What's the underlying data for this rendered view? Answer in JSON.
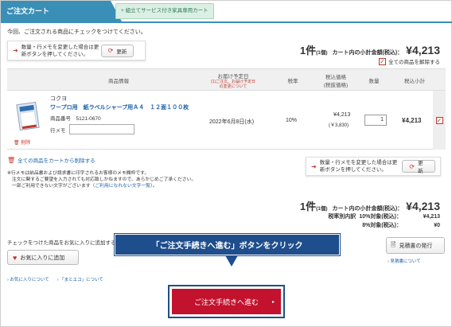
{
  "tabs": {
    "active": "ご注文カート",
    "inactive": "組立てサービス付き家具専用カート",
    "inactive_icon": "plus-icon"
  },
  "notice": "今回、ご注文される商品にチェックをつけてください。",
  "update_box": {
    "message": "数量・行メモを変更した場合は更新ボタンを押してください。",
    "button": "更新"
  },
  "summary": {
    "count": "1件",
    "count_sub": "(1個)",
    "subtotal_label": "カート内の小計金額(税込)：",
    "subtotal": "¥4,213",
    "remove_checked": "全ての商品を解除する"
  },
  "table": {
    "headers": {
      "product": "商品情報",
      "delivery": "お届け予定日",
      "delivery_sub1": "(1)ご注文、お届け予定日",
      "delivery_sub2": "の変更について",
      "tax_rate": "税率",
      "price": "税込価格",
      "price_sub": "(税抜価格)",
      "qty": "数量",
      "line_total": "税込小計"
    },
    "item": {
      "maker": "コクヨ",
      "name": "ワープロ用　紙ラベルシャープ用Ａ４　１２面１００枚",
      "code_label": "商品番号",
      "code": "5121-0670",
      "memo_label": "行メモ",
      "delete": "削除",
      "delivery_date": "2022年6月8日(水)",
      "tax_rate": "10%",
      "price": "¥4,213",
      "price_ex": "(￥3,830)",
      "qty": "1",
      "line_total": "¥4,213",
      "checked": "✓"
    }
  },
  "delete_all": "全ての商品をカートから削除する",
  "notes": {
    "line1": "※行メモは納品書および請求書に印字されるお客様のメモ欄枠です。",
    "line2": "注文に関するご要望を入力されても対応致しかねますので、あらかじめご了承ください。",
    "line3a": "一部ご利用できない文字がございます（",
    "line3_link": "ご利用になれない文字一覧",
    "line3b": "）。"
  },
  "summary_bottom": {
    "count": "1件",
    "count_sub": "(1個)",
    "subtotal_label": "カート内の小計金額(税込)：",
    "subtotal": "¥4,213",
    "breakdown_title": "税率別内訳",
    "rate10_label": "10%対象(税込)：",
    "rate10_value": "¥4,213",
    "rate8_label": "8%対象(税込)：",
    "rate8_value": "¥0"
  },
  "favorites": {
    "caption": "チェックをつけた商品をお気に入りに追加する",
    "button": "お気に入りに追加"
  },
  "callout": "「ご注文手続きへ進む」ボタンをクリック",
  "quote": {
    "button": "見積書の発行",
    "about": "見積書について"
  },
  "links": {
    "fav_about": "お気に入りについて",
    "matome_about": "「まとエコ」について"
  },
  "checkout": {
    "button": "ご注文手続きへ進む",
    "chevron": "▸"
  }
}
